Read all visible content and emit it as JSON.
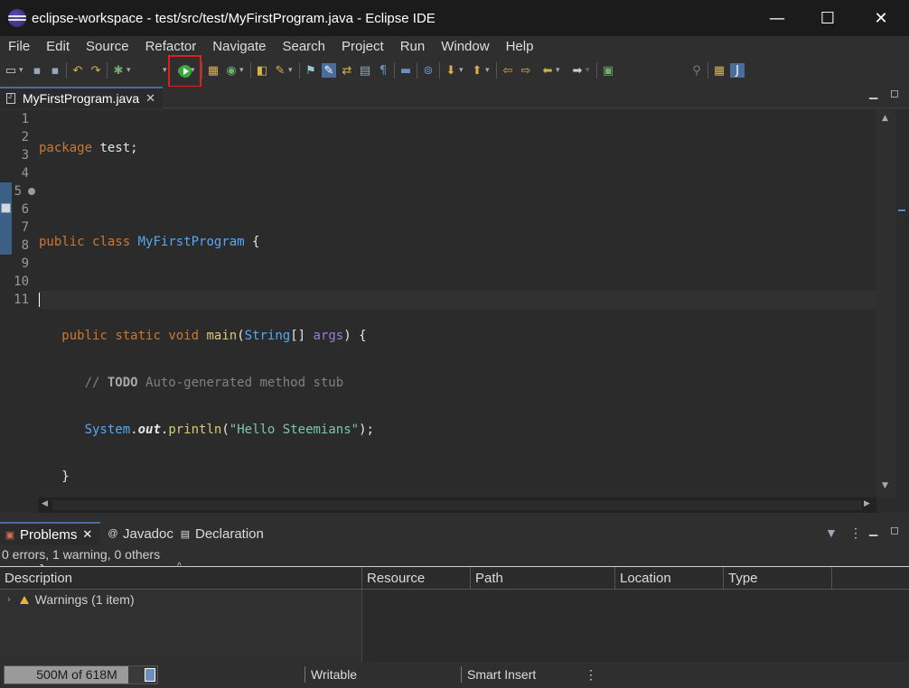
{
  "window": {
    "title": "eclipse-workspace - test/src/test/MyFirstProgram.java - Eclipse IDE",
    "minimize": "—",
    "maximize": "☐",
    "close": "✕"
  },
  "menu": [
    "File",
    "Edit",
    "Source",
    "Refactor",
    "Navigate",
    "Search",
    "Project",
    "Run",
    "Window",
    "Help"
  ],
  "toolbar": {
    "run_button_highlight_color": "#e02020",
    "run_icon": "run-icon"
  },
  "editor": {
    "tab_label": "MyFirstProgram.java",
    "tab_close": "✕",
    "line_numbers": [
      "1",
      "2",
      "3",
      "4",
      "5",
      "6",
      "7",
      "8",
      "9",
      "10",
      "11"
    ],
    "code": {
      "l1_kw": "package",
      "l1_rest": " test;",
      "l3_kw1": "public",
      "l3_kw2": "class",
      "l3_name": "MyFirstProgram",
      "l3_rest": " {",
      "l5_indent": "   ",
      "l5_kw1": "public",
      "l5_kw2": "static",
      "l5_kw3": "void",
      "l5_fn": "main",
      "l5_open": "(",
      "l5_type": "String",
      "l5_arr": "[] ",
      "l5_param": "args",
      "l5_close": ") {",
      "l6_indent": "      ",
      "l6_cmt1": "// ",
      "l6_todo": "TODO",
      "l6_cmt2": " Auto-generated method stub",
      "l7_indent": "      ",
      "l7_sys": "System",
      "l7_dot1": ".",
      "l7_out": "out",
      "l7_dot2": ".",
      "l7_fn": "println",
      "l7_open": "(",
      "l7_str": "\"Hello Steemians\"",
      "l7_close": ");",
      "l8": "   }",
      "l10": "}"
    }
  },
  "bottom": {
    "tabs": [
      "Problems",
      "Javadoc",
      "Declaration"
    ],
    "tab_close": "✕",
    "summary": "0 errors, 1 warning, 0 others",
    "columns": [
      "Description",
      "Resource",
      "Path",
      "Location",
      "Type"
    ],
    "rows": [
      {
        "label": "Warnings (1 item)"
      }
    ]
  },
  "status": {
    "heap": "500M of 618M",
    "heap_used_fraction": 0.81,
    "writable": "Writable",
    "insert_mode": "Smart Insert",
    "more": "⋮"
  }
}
